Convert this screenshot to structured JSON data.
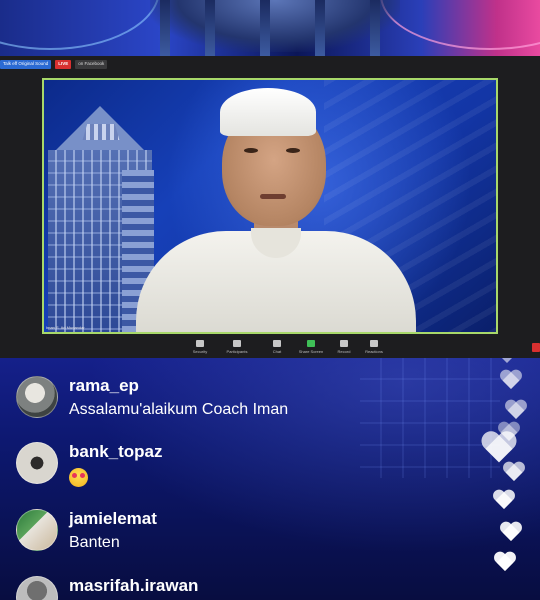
{
  "zoom": {
    "top_chips": [
      "Talk eff Original Sound",
      "LIVE",
      "on Facebook"
    ],
    "video_caption": "Iman S. Ari Munandar",
    "toolbar": [
      "Security",
      "Participants",
      "Chat",
      "Share Screen",
      "Record",
      "Reactions"
    ]
  },
  "comments": [
    {
      "username": "rama_ep",
      "message": "Assalamu'alaikum Coach Iman",
      "avatar": "avatar-1"
    },
    {
      "username": "bank_topaz",
      "message": "",
      "emoji": "smiling-face-with-heart-eyes",
      "avatar": "avatar-2"
    },
    {
      "username": "jamielemat",
      "message": "Banten",
      "avatar": "avatar-3"
    },
    {
      "username": "masrifah.irawan",
      "message": "",
      "avatar": "avatar-4"
    }
  ],
  "colors": {
    "accent_green": "#a8d86a",
    "live_red": "#d83030",
    "chat_bg": "#0d1870"
  }
}
